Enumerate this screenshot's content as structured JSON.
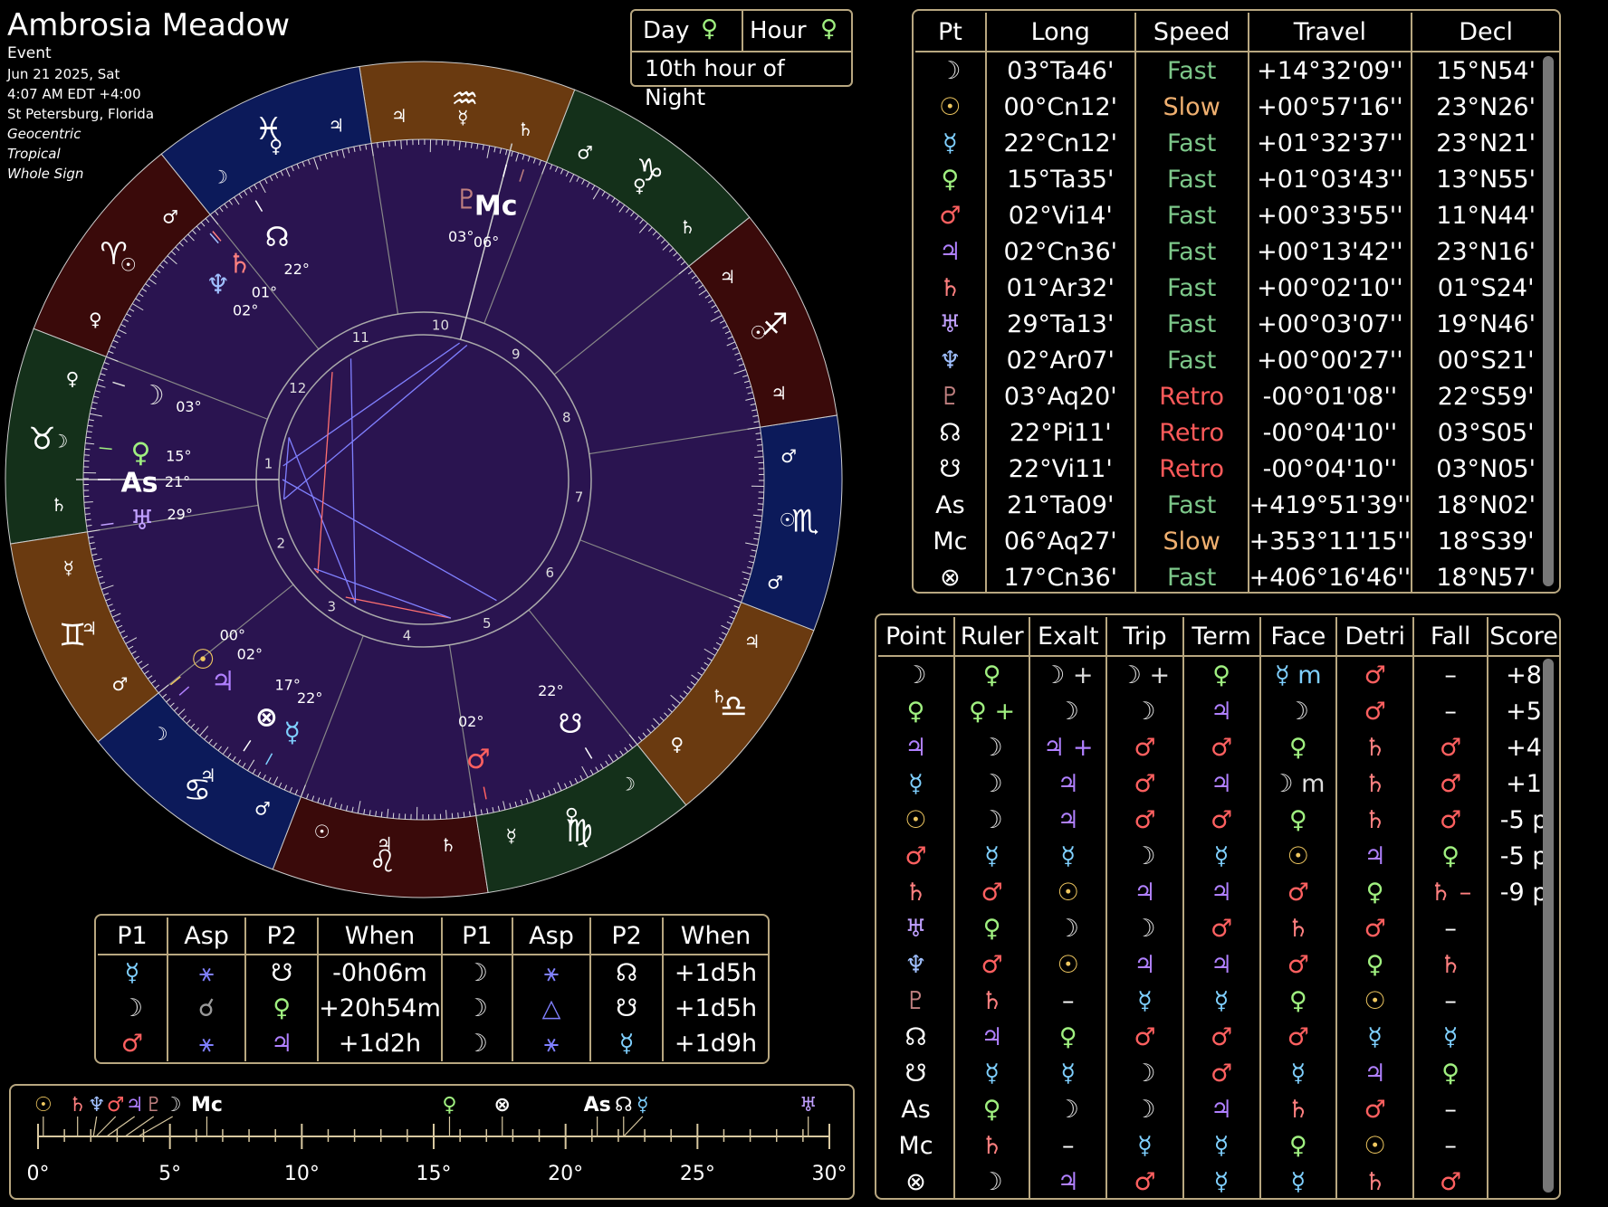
{
  "colors": {
    "bg": "#000000",
    "border": "#b8a780",
    "chart_fill": "#2a1450",
    "fire": "#3a0a0a",
    "earth": "#14301a",
    "air": "#6a3a10",
    "water": "#0c1a5a",
    "fast": "#7dc88a",
    "slow": "#f0b070",
    "retro": "#ff5a5a",
    "moon": "#dddddd",
    "sun": "#f0c860",
    "mercury": "#7fd0ff",
    "venus": "#a0f080",
    "mars": "#ff6060",
    "jupiter": "#b080ff",
    "saturn": "#ff8080",
    "uranus": "#c0a0ff",
    "neptune": "#a0c0ff",
    "pluto": "#c08080",
    "node": "#ffffff"
  },
  "header": {
    "name": "Ambrosia Meadow",
    "type": "Event",
    "date": "Jun 21 2025, Sat",
    "time": "4:07 AM EDT +4:00",
    "place": "St Petersburg, Florida",
    "opt1": "Geocentric",
    "opt2": "Tropical",
    "opt3": "Whole Sign"
  },
  "dayhour": {
    "day_label": "Day",
    "hour_label": "Hour",
    "day_ruler": "♀",
    "hour_ruler": "♀",
    "hour_text": "10th hour of Night"
  },
  "positions": {
    "headers": [
      "Pt",
      "Long",
      "Speed",
      "Travel",
      "Decl"
    ],
    "rows": [
      {
        "pt": "☽",
        "long": "03°Ta46'",
        "speed": "Fast",
        "travel": "+14°32'09''",
        "decl": "15°N54'",
        "c": "moon",
        "s": "fast"
      },
      {
        "pt": "☉",
        "long": "00°Cn12'",
        "speed": "Slow",
        "travel": "+00°57'16''",
        "decl": "23°N26'",
        "c": "sun",
        "s": "slow"
      },
      {
        "pt": "☿",
        "long": "22°Cn12'",
        "speed": "Fast",
        "travel": "+01°32'37''",
        "decl": "23°N21'",
        "c": "mercury",
        "s": "fast"
      },
      {
        "pt": "♀",
        "long": "15°Ta35'",
        "speed": "Fast",
        "travel": "+01°03'43''",
        "decl": "13°N55'",
        "c": "venus",
        "s": "fast"
      },
      {
        "pt": "♂",
        "long": "02°Vi14'",
        "speed": "Fast",
        "travel": "+00°33'55''",
        "decl": "11°N44'",
        "c": "mars",
        "s": "fast"
      },
      {
        "pt": "♃",
        "long": "02°Cn36'",
        "speed": "Fast",
        "travel": "+00°13'42''",
        "decl": "23°N16'",
        "c": "jupiter",
        "s": "fast"
      },
      {
        "pt": "♄",
        "long": "01°Ar32'",
        "speed": "Fast",
        "travel": "+00°02'10''",
        "decl": "01°S24'",
        "c": "saturn",
        "s": "fast"
      },
      {
        "pt": "♅",
        "long": "29°Ta13'",
        "speed": "Fast",
        "travel": "+00°03'07''",
        "decl": "19°N46'",
        "c": "uranus",
        "s": "fast"
      },
      {
        "pt": "♆",
        "long": "02°Ar07'",
        "speed": "Fast",
        "travel": "+00°00'27''",
        "decl": "00°S21'",
        "c": "neptune",
        "s": "fast"
      },
      {
        "pt": "♇",
        "long": "03°Aq20'",
        "speed": "Retro",
        "travel": "-00°01'08''",
        "decl": "22°S59'",
        "c": "pluto",
        "s": "retro"
      },
      {
        "pt": "☊",
        "long": "22°Pi11'",
        "speed": "Retro",
        "travel": "-00°04'10''",
        "decl": "03°S05'",
        "c": "node",
        "s": "retro"
      },
      {
        "pt": "☋",
        "long": "22°Vi11'",
        "speed": "Retro",
        "travel": "-00°04'10''",
        "decl": "03°N05'",
        "c": "node",
        "s": "retro"
      },
      {
        "pt": "As",
        "long": "21°Ta09'",
        "speed": "Fast",
        "travel": "+419°51'39''",
        "decl": "18°N02'",
        "c": "node",
        "s": "fast"
      },
      {
        "pt": "Mc",
        "long": "06°Aq27'",
        "speed": "Slow",
        "travel": "+353°11'15''",
        "decl": "18°S39'",
        "c": "node",
        "s": "slow"
      },
      {
        "pt": "⊗",
        "long": "17°Cn36'",
        "speed": "Fast",
        "travel": "+406°16'46''",
        "decl": "18°N57'",
        "c": "node",
        "s": "fast"
      }
    ]
  },
  "dignities": {
    "headers": [
      "Point",
      "Ruler",
      "Exalt",
      "Trip",
      "Term",
      "Face",
      "Detri",
      "Fall",
      "Score"
    ],
    "rows": [
      [
        "☽",
        "♀",
        "☽ +",
        "☽ +",
        "♀",
        "☿ m",
        "♂",
        "–",
        "+8"
      ],
      [
        "♀",
        "♀ +",
        "☽",
        "☽",
        "♃",
        "☽",
        "♂",
        "–",
        "+5"
      ],
      [
        "♃",
        "☽",
        "♃ +",
        "♂",
        "♂",
        "♀",
        "♄",
        "♂",
        "+4"
      ],
      [
        "☿",
        "☽",
        "♃",
        "♂",
        "♃",
        "☽ m",
        "♄",
        "♂",
        "+1"
      ],
      [
        "☉",
        "☽",
        "♃",
        "♂",
        "♂",
        "♀",
        "♄",
        "♂",
        "-5 p"
      ],
      [
        "♂",
        "☿",
        "☿",
        "☽",
        "☿",
        "☉",
        "♃",
        "♀",
        "-5 p"
      ],
      [
        "♄",
        "♂",
        "☉",
        "♃",
        "♃",
        "♂",
        "♀",
        "♄ –",
        "-9 p"
      ],
      [
        "♅",
        "♀",
        "☽",
        "☽",
        "♂",
        "♄",
        "♂",
        "–",
        ""
      ],
      [
        "♆",
        "♂",
        "☉",
        "♃",
        "♃",
        "♂",
        "♀",
        "♄",
        ""
      ],
      [
        "♇",
        "♄",
        "–",
        "☿",
        "☿",
        "♀",
        "☉",
        "–",
        ""
      ],
      [
        "☊",
        "♃",
        "♀",
        "♂",
        "♂",
        "♂",
        "☿",
        "☿",
        ""
      ],
      [
        "☋",
        "☿",
        "☿",
        "☽",
        "♂",
        "☿",
        "♃",
        "♀",
        ""
      ],
      [
        "As",
        "♀",
        "☽",
        "☽",
        "♃",
        "♄",
        "♂",
        "–",
        ""
      ],
      [
        "Mc",
        "♄",
        "–",
        "☿",
        "☿",
        "♀",
        "☉",
        "–",
        ""
      ],
      [
        "⊗",
        "☽",
        "♃",
        "♂",
        "☿",
        "☿",
        "♄",
        "♂",
        ""
      ]
    ]
  },
  "aspects": {
    "headers": [
      "P1",
      "Asp",
      "P2",
      "When",
      "P1",
      "Asp",
      "P2",
      "When"
    ],
    "rows": [
      [
        "☿",
        "⚹",
        "☋",
        "-0h06m",
        "☽",
        "⚹",
        "☊",
        "+1d5h"
      ],
      [
        "☽",
        "☌",
        "♀",
        "+20h54m",
        "☽",
        "△",
        "☋",
        "+1d5h"
      ],
      [
        "♂",
        "⚹",
        "♃",
        "+1d2h",
        "☽",
        "⚹",
        "☿",
        "+1d9h"
      ]
    ]
  },
  "zone": {
    "ticks": [
      "0°",
      "5°",
      "10°",
      "15°",
      "20°",
      "25°",
      "30°"
    ],
    "points": [
      {
        "g": "☉",
        "deg": 0.2,
        "c": "sun"
      },
      {
        "g": "♄",
        "deg": 1.5,
        "c": "saturn"
      },
      {
        "g": "♆",
        "deg": 2.1,
        "c": "neptune"
      },
      {
        "g": "♂",
        "deg": 2.2,
        "c": "mars"
      },
      {
        "g": "♃",
        "deg": 2.6,
        "c": "jupiter"
      },
      {
        "g": "♇",
        "deg": 3.3,
        "c": "pluto"
      },
      {
        "g": "☽",
        "deg": 3.8,
        "c": "moon"
      },
      {
        "g": "Mc",
        "deg": 6.4,
        "c": "node"
      },
      {
        "g": "♀",
        "deg": 15.6,
        "c": "venus"
      },
      {
        "g": "⊗",
        "deg": 17.6,
        "c": "node"
      },
      {
        "g": "As",
        "deg": 21.2,
        "c": "node"
      },
      {
        "g": "☊",
        "deg": 22.2,
        "c": "node"
      },
      {
        "g": "☿",
        "deg": 22.2,
        "c": "mercury"
      },
      {
        "g": "♅",
        "deg": 29.2,
        "c": "uranus"
      }
    ]
  },
  "wheel": {
    "signs": [
      {
        "g": "♈",
        "c": "#ffffff",
        "rulers": [
          "♂",
          "☉",
          "♀"
        ]
      },
      {
        "g": "♉",
        "c": "#ffffff",
        "rulers": [
          "♀",
          "☽",
          "♄"
        ]
      },
      {
        "g": "♊",
        "c": "#ffffff",
        "rulers": [
          "☿",
          "♃",
          "♂"
        ]
      },
      {
        "g": "♋",
        "c": "#ffffff",
        "rulers": [
          "☽",
          "♃",
          "♂"
        ]
      },
      {
        "g": "♌",
        "c": "#ffffff",
        "rulers": [
          "☉",
          "♃",
          "♄"
        ]
      },
      {
        "g": "♍",
        "c": "#ffffff",
        "rulers": [
          "☿",
          "♀",
          "☽"
        ]
      },
      {
        "g": "♎",
        "c": "#ffffff",
        "rulers": [
          "♀",
          "♄",
          "♃"
        ]
      },
      {
        "g": "♏",
        "c": "#ffffff",
        "rulers": [
          "♂",
          "☉",
          "♂"
        ]
      },
      {
        "g": "♐",
        "c": "#ffffff",
        "rulers": [
          "♃",
          "☉",
          "♃"
        ]
      },
      {
        "g": "♑",
        "c": "#ffffff",
        "rulers": [
          "♄",
          "♀",
          "♂"
        ]
      },
      {
        "g": "♒",
        "c": "#ffffff",
        "rulers": [
          "♄",
          "☿",
          "♃"
        ]
      },
      {
        "g": "♓",
        "c": "#ffffff",
        "rulers": [
          "♃",
          "♀",
          "☽"
        ]
      }
    ],
    "houses": [
      "1",
      "2",
      "3",
      "4",
      "5",
      "6",
      "7",
      "8",
      "9",
      "10",
      "11",
      "12"
    ],
    "asc_label": "As",
    "mc_label": "Mc",
    "planets": [
      {
        "g": "☽",
        "lon": 33.77,
        "deg": "03°",
        "sg": "♉",
        "min": "46'",
        "c": "moon"
      },
      {
        "g": "♀",
        "lon": 45.58,
        "deg": "15°",
        "sg": "♉",
        "min": "35'",
        "c": "venus"
      },
      {
        "g": "As",
        "lon": 51.15,
        "deg": "21°",
        "sg": "♉",
        "min": "09'",
        "c": "node"
      },
      {
        "g": "♅",
        "lon": 59.2,
        "deg": "29°",
        "sg": "♉",
        "min": "13'",
        "c": "uranus"
      },
      {
        "g": "☉",
        "lon": 90.2,
        "deg": "00°",
        "sg": "♋",
        "min": "12'",
        "c": "sun"
      },
      {
        "g": "♃",
        "lon": 92.6,
        "deg": "02°",
        "sg": "♋",
        "min": "36'",
        "c": "jupiter"
      },
      {
        "g": "⊗",
        "lon": 107.6,
        "deg": "17°",
        "sg": "♋",
        "min": "36'",
        "c": "node"
      },
      {
        "g": "☿",
        "lon": 112.2,
        "deg": "22°",
        "sg": "♋",
        "min": "12'",
        "c": "mercury"
      },
      {
        "g": "♂",
        "lon": 152.2,
        "deg": "02°",
        "sg": "♍",
        "min": "14'",
        "c": "mars"
      },
      {
        "g": "☋",
        "lon": 172.2,
        "deg": "22°",
        "sg": "♍",
        "min": "11'",
        "c": "node"
      },
      {
        "g": "Mc",
        "lon": 306.45,
        "deg": "06°",
        "sg": "♒",
        "min": "27'",
        "c": "node"
      },
      {
        "g": "♇",
        "lon": 303.3,
        "deg": "03°",
        "sg": "♒",
        "min": "20'",
        "c": "pluto"
      },
      {
        "g": "☊",
        "lon": 352.2,
        "deg": "22°",
        "sg": "♓",
        "min": "11'",
        "c": "node"
      },
      {
        "g": "♄",
        "lon": 1.5,
        "deg": "01°",
        "sg": "♈",
        "min": "32'",
        "c": "saturn"
      },
      {
        "g": "♆",
        "lon": 2.1,
        "deg": "02°",
        "sg": "♈",
        "min": "07'",
        "c": "neptune"
      }
    ]
  }
}
